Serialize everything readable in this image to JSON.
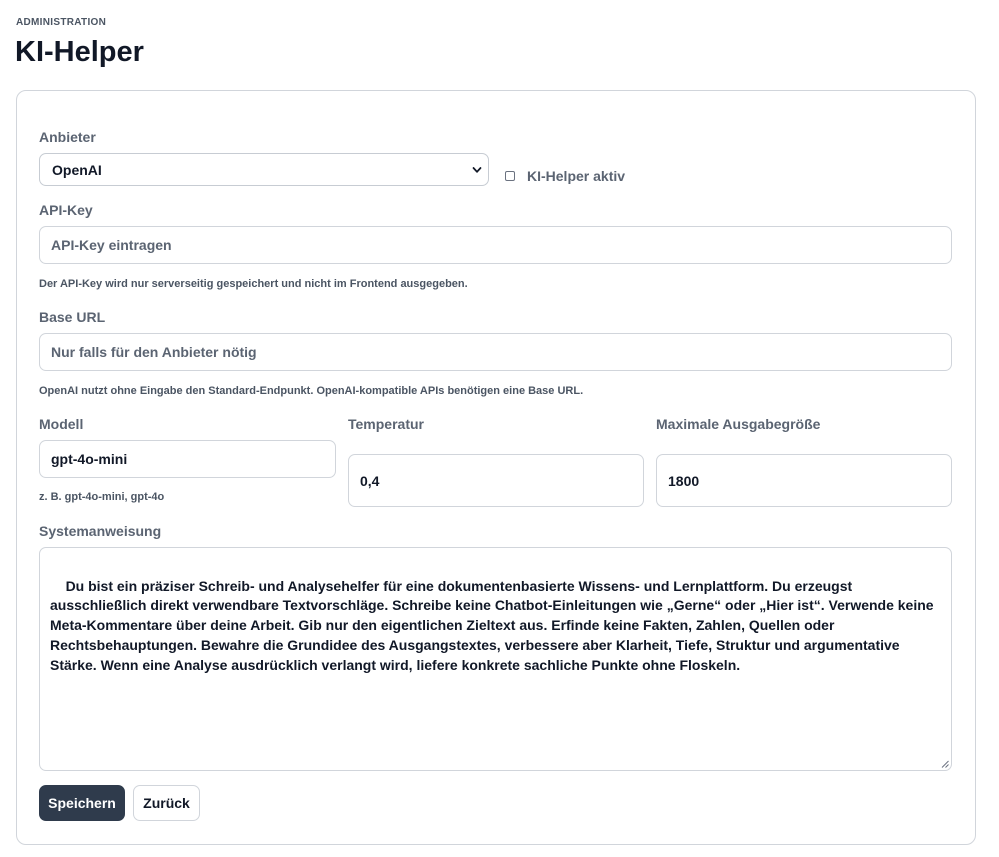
{
  "header": {
    "eyebrow": "ADMINISTRATION",
    "title": "KI-Helper"
  },
  "form": {
    "provider": {
      "label": "Anbieter",
      "selected": "OpenAI",
      "icon": "chevron-down-icon"
    },
    "active_toggle": {
      "label": "KI-Helper aktiv",
      "checked": false
    },
    "api_key": {
      "label": "API-Key",
      "placeholder": "API-Key eintragen",
      "value": "",
      "hint": "Der API-Key wird nur serverseitig gespeichert und nicht im Frontend ausgegeben."
    },
    "base_url": {
      "label": "Base URL",
      "placeholder": "Nur falls für den Anbieter nötig",
      "value": "",
      "hint": "OpenAI nutzt ohne Eingabe den Standard-Endpunkt. OpenAI-kompatible APIs benötigen eine Base URL."
    },
    "model": {
      "label": "Modell",
      "value": "gpt-4o-mini",
      "hint": "z. B. gpt-4o-mini, gpt-4o"
    },
    "temperature": {
      "label": "Temperatur",
      "value": "0,4"
    },
    "max_output": {
      "label": "Maximale Ausgabegröße",
      "value": "1800"
    },
    "system_prompt": {
      "label": "Systemanweisung",
      "value": "Du bist ein präziser Schreib- und Analysehelfer für eine dokumentenbasierte Wissens- und Lernplattform. Du erzeugst ausschließlich direkt verwendbare Textvorschläge. Schreibe keine Chatbot-Einleitungen wie „Gerne“ oder „Hier ist“. Verwende keine Meta-Kommentare über deine Arbeit. Gib nur den eigentlichen Zieltext aus. Erfinde keine Fakten, Zahlen, Quellen oder Rechtsbehauptungen. Bewahre die Grundidee des Ausgangstextes, verbessere aber Klarheit, Tiefe, Struktur und argumentative Stärke. Wenn eine Analyse ausdrücklich verlangt wird, liefere konkrete sachliche Punkte ohne Floskeln."
    },
    "buttons": {
      "save": "Speichern",
      "back": "Zurück"
    }
  },
  "colors": {
    "primary_button": "#2f3b4c",
    "label_text": "#5b6472",
    "border": "#d1d5db"
  }
}
